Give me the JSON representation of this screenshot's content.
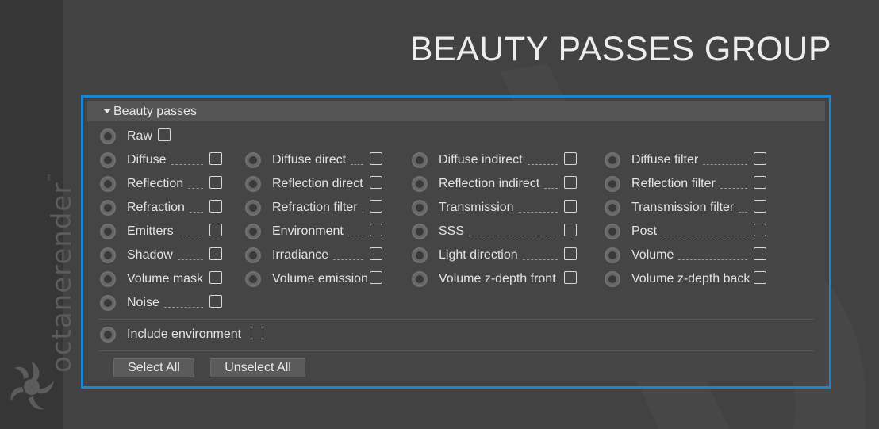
{
  "brand": {
    "name": "octanerender",
    "tm": "™"
  },
  "title": "BEAUTY PASSES GROUP",
  "panel": {
    "header": "Beauty passes",
    "raw": "Raw",
    "grid": [
      [
        "Diffuse",
        "Diffuse direct",
        "Diffuse indirect",
        "Diffuse filter"
      ],
      [
        "Reflection",
        "Reflection direct",
        "Reflection indirect",
        "Reflection filter"
      ],
      [
        "Refraction",
        "Refraction filter",
        "Transmission",
        "Transmission filter"
      ],
      [
        "Emitters",
        "Environment",
        "SSS",
        "Post"
      ],
      [
        "Shadow",
        "Irradiance",
        "Light direction",
        "Volume"
      ],
      [
        "Volume mask",
        "Volume emission",
        "Volume z-depth front",
        "Volume z-depth back"
      ],
      [
        "Noise"
      ]
    ],
    "include_env": "Include environment",
    "select_all": "Select All",
    "unselect_all": "Unselect All"
  },
  "colors": {
    "accent": "#1a86d1",
    "background": "#424242",
    "panel": "#454545"
  }
}
